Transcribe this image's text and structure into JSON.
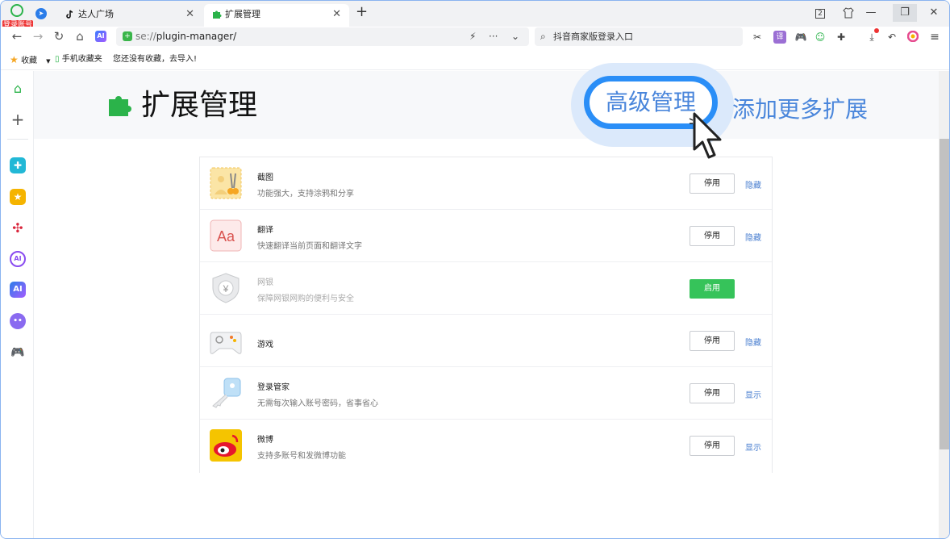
{
  "browser": {
    "login_badge": "登录账号",
    "tabs": [
      {
        "label": "达人广场",
        "close": "✕"
      },
      {
        "label": "扩展管理",
        "close": "✕"
      }
    ],
    "new_tab": "+",
    "window_controls": {
      "tab_count": "2",
      "minimize": "—",
      "restore": "❐",
      "close": "✕"
    },
    "url_scheme": "se://",
    "url_path": "plugin-manager/",
    "search_placeholder": "抖音商家版登录入口",
    "icons": {
      "back": "←",
      "forward": "→",
      "reload": "↻",
      "home": "⌂",
      "ai": "AI",
      "lightning": "⚡",
      "more": "···",
      "chevron": "⌄",
      "search": "⌕",
      "scissors": "✂",
      "menu": "≡",
      "undo": "↶",
      "puzzle": "✚"
    }
  },
  "bookmarks": {
    "favorites": "收藏",
    "mobile": "手机收藏夹",
    "hint": "您还没有收藏，去导入!"
  },
  "sidebar": {
    "items": [
      "home-icon",
      "add-icon",
      "app1-icon",
      "star-icon",
      "net-icon",
      "ai-chat-icon",
      "ai-icon",
      "robot-icon",
      "game-icon"
    ]
  },
  "page": {
    "title": "扩展管理",
    "advanced": "高级管理",
    "add_more": "添加更多扩展"
  },
  "extensions": [
    {
      "name": "截图",
      "desc": "功能强大，支持涂鸦和分享",
      "action": "停用",
      "link": "隐藏",
      "enabled": true
    },
    {
      "name": "翻译",
      "desc": "快速翻译当前页面和翻译文字",
      "action": "停用",
      "link": "隐藏",
      "enabled": true
    },
    {
      "name": "网银",
      "desc": "保障网银网购的便利与安全",
      "action": "启用",
      "link": "",
      "enabled": false
    },
    {
      "name": "游戏",
      "desc": "",
      "action": "停用",
      "link": "隐藏",
      "enabled": true
    },
    {
      "name": "登录管家",
      "desc": "无需每次输入账号密码，省事省心",
      "action": "停用",
      "link": "显示",
      "enabled": true
    },
    {
      "name": "微博",
      "desc": "支持多账号和发微博功能",
      "action": "停用",
      "link": "显示",
      "enabled": true
    }
  ],
  "colors": {
    "accent_blue": "#2a8ef7",
    "link_blue": "#4a86db",
    "enable_green": "#36c35a",
    "puzzle_green": "#2bb34a"
  }
}
